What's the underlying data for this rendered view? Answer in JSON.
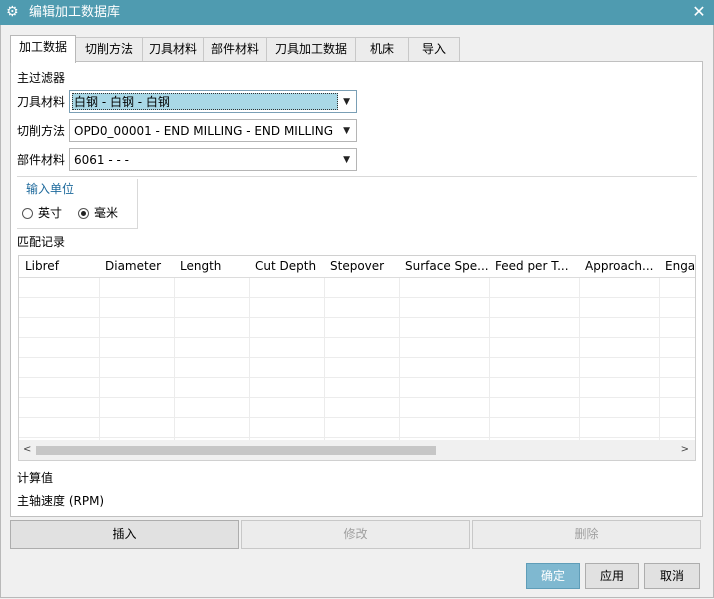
{
  "window": {
    "title": "编辑加工数据库",
    "icon": "gear-icon",
    "close": "✕"
  },
  "tabs": [
    {
      "label": "加工数据",
      "active": true
    },
    {
      "label": "切削方法"
    },
    {
      "label": "刀具材料"
    },
    {
      "label": "部件材料"
    },
    {
      "label": "刀具加工数据"
    },
    {
      "label": "机床"
    },
    {
      "label": "导入"
    }
  ],
  "filter": {
    "heading": "主过滤器",
    "tool_material": {
      "label": "刀具材料",
      "value": "白钢 - 白钢 - 白钢"
    },
    "cut_method": {
      "label": "切削方法",
      "value": "OPD0_00001 - END MILLING - END MILLING"
    },
    "part_material": {
      "label": "部件材料",
      "value": "6061 -  -  -"
    }
  },
  "units": {
    "heading": "输入单位",
    "inch": "英寸",
    "mm": "毫米",
    "selected": "mm"
  },
  "records": {
    "heading": "匹配记录",
    "columns": [
      "Libref",
      "Diameter",
      "Length",
      "Cut Depth",
      "Stepover",
      "Surface Spe...",
      "Feed per T...",
      "Approach...",
      "Enga"
    ],
    "rows": 8
  },
  "computed": {
    "heading": "计算值",
    "spindle_speed": "主轴速度 (RPM)"
  },
  "actions": {
    "insert": "插入",
    "modify": "修改",
    "delete": "删除"
  },
  "footer": {
    "ok": "确定",
    "apply": "应用",
    "cancel": "取消"
  },
  "colors": {
    "titlebar": "#4f9bb0",
    "selection": "#a9d8e6",
    "primary_button": "#7fb8d0"
  }
}
